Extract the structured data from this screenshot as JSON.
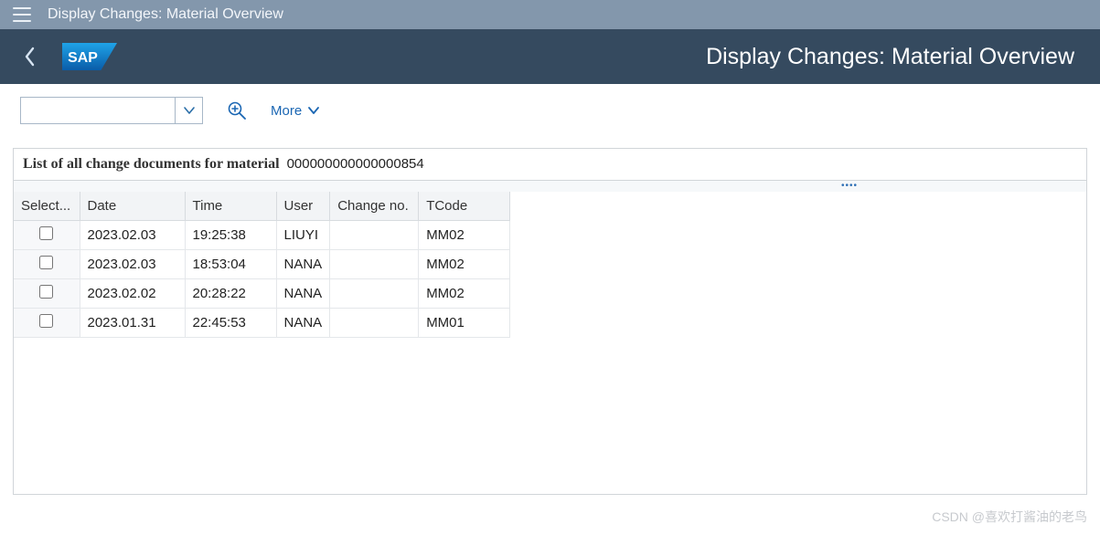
{
  "topbar": {
    "title": "Display Changes: Material Overview"
  },
  "header": {
    "title": "Display Changes: Material Overview"
  },
  "toolbar": {
    "dropdown_value": "",
    "more_label": "More"
  },
  "list": {
    "caption": "List of all change documents for material",
    "material_number": "000000000000000854"
  },
  "table": {
    "headers": {
      "select": "Select...",
      "date": "Date",
      "time": "Time",
      "user": "User",
      "change_no": "Change no.",
      "tcode": "TCode"
    },
    "rows": [
      {
        "date": "2023.02.03",
        "time": "19:25:38",
        "user": "LIUYI",
        "change_no": "",
        "tcode": "MM02"
      },
      {
        "date": "2023.02.03",
        "time": "18:53:04",
        "user": "NANA",
        "change_no": "",
        "tcode": "MM02"
      },
      {
        "date": "2023.02.02",
        "time": "20:28:22",
        "user": "NANA",
        "change_no": "",
        "tcode": "MM02"
      },
      {
        "date": "2023.01.31",
        "time": "22:45:53",
        "user": "NANA",
        "change_no": "",
        "tcode": "MM01"
      }
    ]
  },
  "watermark": "CSDN @喜欢打酱油的老鸟"
}
